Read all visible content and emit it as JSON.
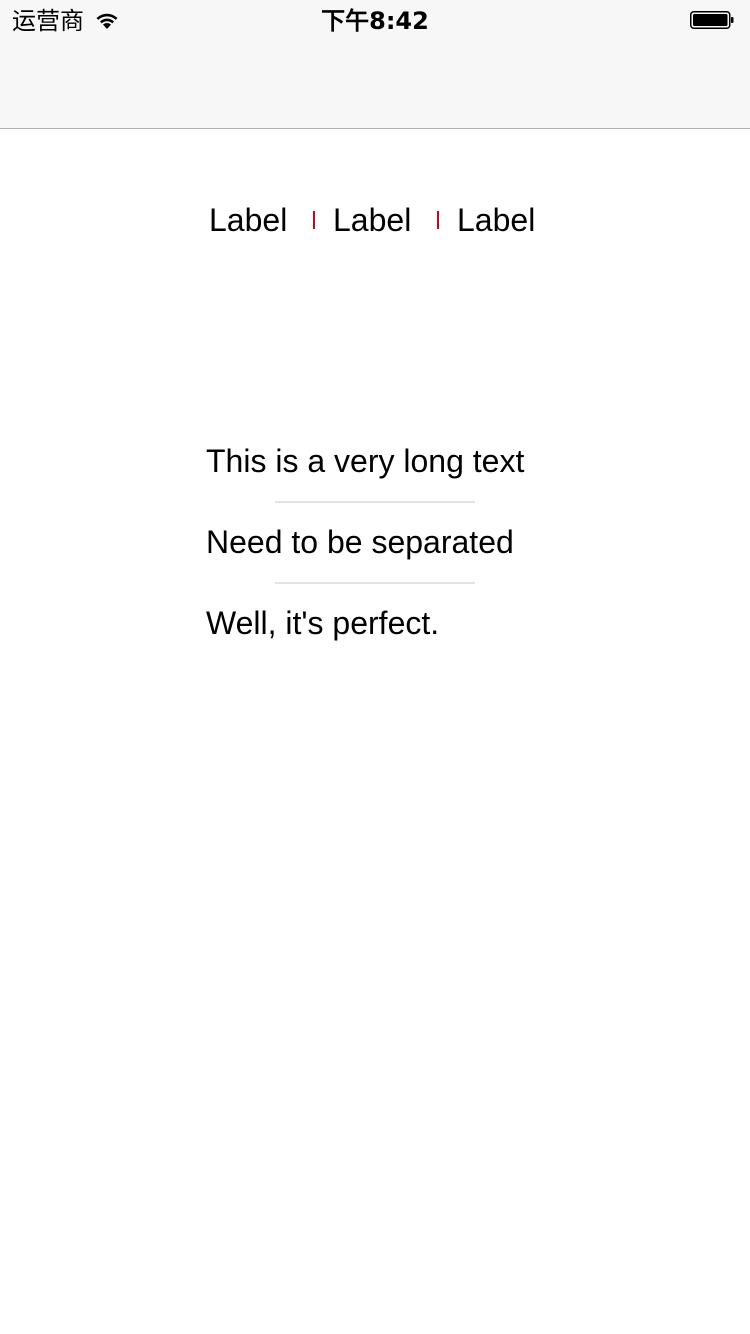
{
  "status_bar": {
    "carrier": "运营商",
    "time": "下午8:42",
    "wifi_icon": "wifi-icon",
    "battery_icon": "battery-icon",
    "battery_level": 1.0
  },
  "label_row": {
    "labels": [
      "Label",
      "Label",
      "Label"
    ],
    "separator_color": "#d0021b"
  },
  "text_stack": {
    "lines": [
      "This is a very long text",
      "Need to be separated",
      "Well, it's perfect."
    ],
    "separator_color": "#e3e3e3"
  }
}
